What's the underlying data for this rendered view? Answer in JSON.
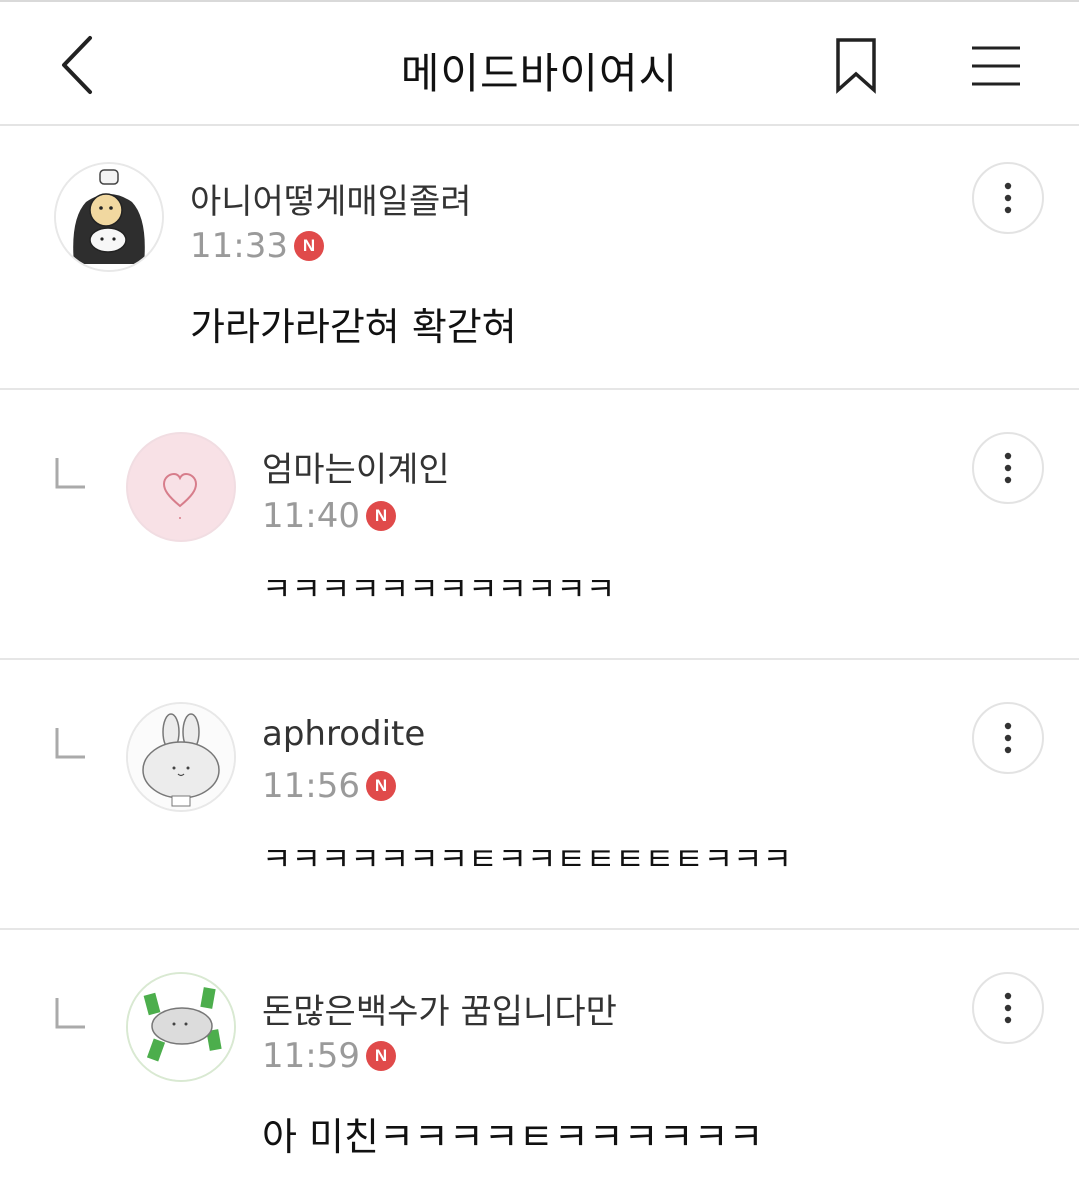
{
  "header": {
    "title": "메이드바이여시",
    "back_icon": "chevron-left-icon",
    "bookmark_icon": "bookmark-icon",
    "menu_icon": "hamburger-menu-icon"
  },
  "badge_label": "N",
  "comments": [
    {
      "author": "아니어떻게매일졸려",
      "time": "11:33",
      "text": "가라가라갇혀 확갇혀",
      "is_reply": false
    },
    {
      "author": "엄마는이계인",
      "time": "11:40",
      "text": "ㅋㅋㅋㅋㅋㅋㅋㅋㅋㅋㅋㅋ",
      "is_reply": true
    },
    {
      "author": "aphrodite",
      "time": "11:56",
      "text": "ㅋㅋㅋㅋㅋㅋㅋㅌㅋㅋㅌㅌㅌㅌㅌㅋㅋㅋ",
      "is_reply": true
    },
    {
      "author": "돈많은백수가 꿈입니다만",
      "time": "11:59",
      "text": "아 미친ㅋㅋㅋㅋㅌㅋㅋㅋㅋㅋㅋ",
      "is_reply": true
    }
  ],
  "colors": {
    "badge": "#e04a4a",
    "divider": "#e6e6e6",
    "time": "#9a9a9a"
  }
}
